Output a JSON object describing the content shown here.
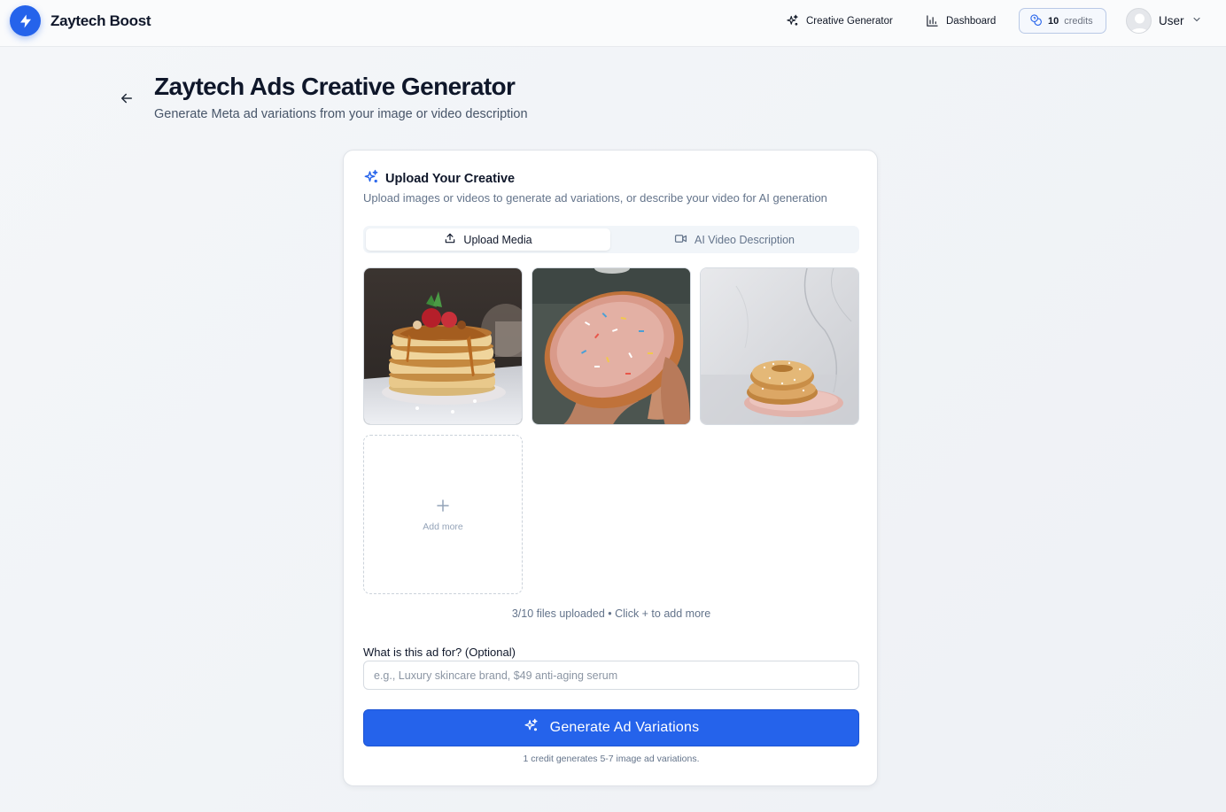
{
  "app": {
    "brand": "Zaytech Boost"
  },
  "nav": {
    "creative_generator": "Creative Generator",
    "dashboard": "Dashboard",
    "credits_count": "10",
    "credits_label": "credits",
    "user_name": "User"
  },
  "page": {
    "title": "Zaytech Ads Creative Generator",
    "subtitle": "Generate Meta ad variations from your image or video description"
  },
  "card": {
    "title": "Upload Your Creative",
    "description": "Upload images or videos to generate ad variations, or describe your video for AI generation",
    "tabs": [
      {
        "label": "Upload Media",
        "active": true
      },
      {
        "label": "AI Video Description",
        "active": false
      }
    ],
    "thumbnails": [
      "pancake-stack-image",
      "sprinkle-donut-in-hand-image",
      "sugar-donuts-on-plate-image"
    ],
    "add_more_label": "Add more",
    "files_status": "3/10 files uploaded • Click + to add more",
    "ad_field_label": "What is this ad for? (Optional)",
    "ad_field_placeholder": "e.g., Luxury skincare brand, $49 anti-aging serum",
    "ad_field_value": "",
    "generate_button": "Generate Ad Variations",
    "credit_note": "1 credit generates 5-7 image ad variations."
  },
  "colors": {
    "accent": "#2563eb",
    "text": "#0f172a",
    "muted": "#64748b"
  }
}
